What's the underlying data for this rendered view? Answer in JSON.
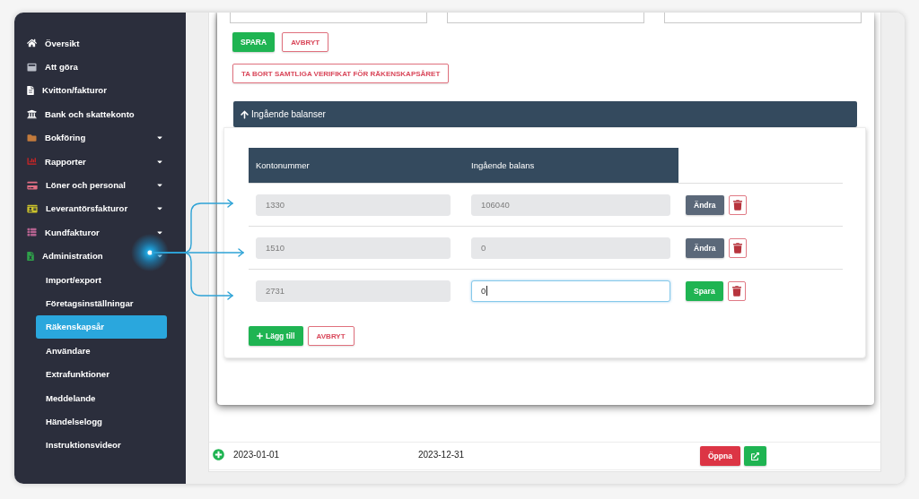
{
  "sidebar": {
    "items": [
      {
        "label": "Översikt",
        "selected": false,
        "expandable": false
      },
      {
        "label": "Att göra",
        "selected": false,
        "expandable": false
      },
      {
        "label": "Kvitton/fakturor",
        "selected": false,
        "expandable": false
      },
      {
        "label": "Bank och skattekonto",
        "selected": false,
        "expandable": false
      },
      {
        "label": "Bokföring",
        "selected": false,
        "expandable": true
      },
      {
        "label": "Rapporter",
        "selected": false,
        "expandable": true
      },
      {
        "label": "Löner och personal",
        "selected": false,
        "expandable": true
      },
      {
        "label": "Leverantörsfakturor",
        "selected": false,
        "expandable": true
      },
      {
        "label": "Kundfakturor",
        "selected": false,
        "expandable": true
      },
      {
        "label": "Administration",
        "selected": false,
        "expandable": true,
        "children": [
          {
            "label": "Import/export",
            "selected": false
          },
          {
            "label": "Företagsinställningar",
            "selected": false
          },
          {
            "label": "Räkenskapsår",
            "selected": true
          },
          {
            "label": "Användare",
            "selected": false
          },
          {
            "label": "Extrafunktioner",
            "selected": false
          },
          {
            "label": "Meddelande",
            "selected": false
          },
          {
            "label": "Händelselogg",
            "selected": false
          },
          {
            "label": "Instruktionsvideor",
            "selected": false
          }
        ]
      }
    ]
  },
  "form": {
    "save_button": "SPARA",
    "cancel_button": "AVBRYT",
    "delete_all_button": "TA BORT SAMTLIGA VERIFIKAT FÖR RÄKENSKAPSÅRET"
  },
  "opening_balances": {
    "title": "Ingående balanser",
    "expanded": true,
    "columns": [
      "Kontonummer",
      "Ingående balans"
    ],
    "rows": [
      {
        "account": "1330",
        "balance": "106040",
        "editing": false,
        "action": "Ändra"
      },
      {
        "account": "1510",
        "balance": "0",
        "editing": false,
        "action": "Ändra"
      },
      {
        "account": "2731",
        "balance": "0",
        "editing": true,
        "action": "Spara"
      }
    ],
    "add_button": "Lägg till",
    "cancel_button": "AVBRYT"
  },
  "fiscal_years": [
    {
      "start": "2023-01-01",
      "end": "2023-12-31",
      "open_button": "Öppna"
    }
  ]
}
